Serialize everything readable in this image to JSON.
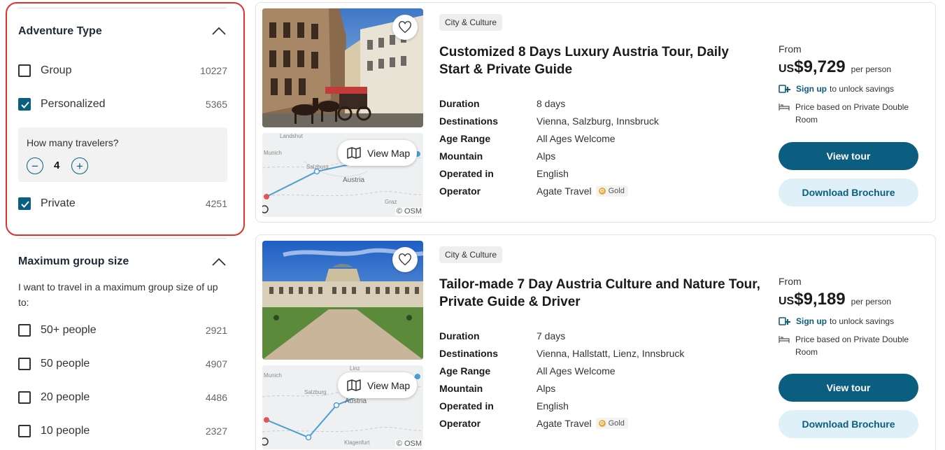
{
  "sidebar": {
    "adventure_type": {
      "title": "Adventure Type",
      "options": [
        {
          "label": "Group",
          "count": "10227",
          "checked": false
        },
        {
          "label": "Personalized",
          "count": "5365",
          "checked": true
        },
        {
          "label": "Private",
          "count": "4251",
          "checked": true
        }
      ],
      "travelers": {
        "question": "How many travelers?",
        "value": "4",
        "minus": "−",
        "plus": "+"
      }
    },
    "group_size": {
      "title": "Maximum group size",
      "description": "I want to travel in a maximum group size of up to:",
      "options": [
        {
          "label": "50+ people",
          "count": "2921",
          "checked": false
        },
        {
          "label": "50 people",
          "count": "4907",
          "checked": false
        },
        {
          "label": "20 people",
          "count": "4486",
          "checked": false
        },
        {
          "label": "10 people",
          "count": "2327",
          "checked": false
        }
      ]
    }
  },
  "labels": {
    "duration": "Duration",
    "destinations": "Destinations",
    "age_range": "Age Range",
    "mountain": "Mountain",
    "operated_in": "Operated in",
    "operator": "Operator",
    "from": "From",
    "per_person": "per person",
    "sign_up": "Sign up",
    "unlock": "to unlock savings",
    "view_map": "View Map",
    "view_tour": "View tour",
    "download": "Download Brochure",
    "osm": "© OSM",
    "gold": "Gold",
    "gold_mark": "✪"
  },
  "tours": [
    {
      "category": "City & Culture",
      "title": "Customized 8 Days Luxury Austria Tour, Daily Start & Private Guide",
      "duration": "8 days",
      "destinations": "Vienna, Salzburg, Innsbruck",
      "age_range": "All Ages Welcome",
      "mountain": "Alps",
      "operated_in": "English",
      "operator": "Agate Travel",
      "currency": "US",
      "price": "$9,729",
      "price_basis": "Price based on Private Double Room",
      "map_labels": [
        "Landshut",
        "Munich",
        "Salzburg",
        "Austria",
        "Graz"
      ]
    },
    {
      "category": "City & Culture",
      "title": "Tailor-made 7 Day Austria Culture and Nature Tour, Private Guide & Driver",
      "duration": "7 days",
      "destinations": "Vienna, Hallstatt, Lienz, Innsbruck",
      "age_range": "All Ages Welcome",
      "mountain": "Alps",
      "operated_in": "English",
      "operator": "Agate Travel",
      "currency": "US",
      "price": "$9,189",
      "price_basis": "Price based on Private Double Room",
      "map_labels": [
        "Linz",
        "Munich",
        "Salzburg",
        "Austria",
        "Klagenfurt"
      ]
    }
  ],
  "colors": {
    "accent": "#0b5e7f",
    "highlight": "#e0322b",
    "secondary_button": "#dff0f8"
  },
  "icons": [
    "chevron-up-icon",
    "checkbox-icon",
    "heart-icon",
    "map-icon",
    "member-icon",
    "bed-icon"
  ]
}
